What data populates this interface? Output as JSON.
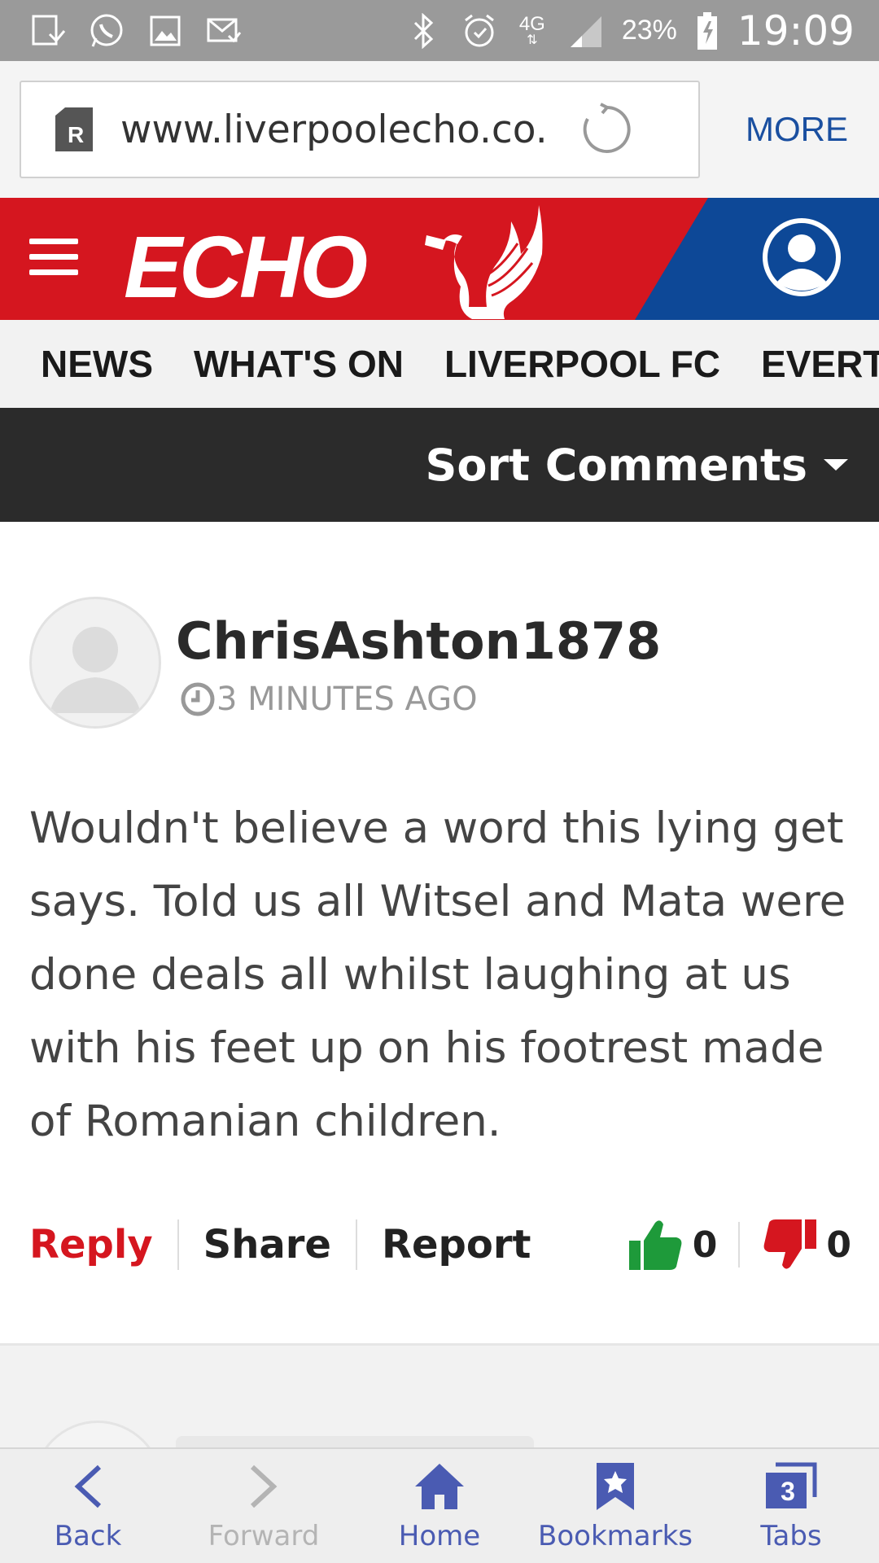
{
  "status_bar": {
    "battery_percent": "23%",
    "network": "4G",
    "time": "19:09"
  },
  "browser": {
    "url": "www.liverpoolecho.co.",
    "more_label": "MORE"
  },
  "header": {
    "logo_text": "ECHO",
    "brand_red": "#d5161f",
    "brand_blue": "#0d4897"
  },
  "nav": {
    "items": [
      "NEWS",
      "WHAT'S ON",
      "LIVERPOOL FC",
      "EVERT"
    ]
  },
  "sort": {
    "label": "Sort Comments"
  },
  "comment": {
    "username": "ChrisAshton1878",
    "time": "3 MINUTES AGO",
    "body": "Wouldn't believe a word this lying get says. Told us all Witsel and Mata were done deals all whilst laughing at us with his feet up on his footrest made of Romanian children.",
    "actions": {
      "reply": "Reply",
      "share": "Share",
      "report": "Report"
    },
    "upvotes": "0",
    "downvotes": "0",
    "up_color": "#1e9a3a",
    "down_color": "#d5161f"
  },
  "toolbar": {
    "back": "Back",
    "forward": "Forward",
    "home": "Home",
    "bookmarks": "Bookmarks",
    "tabs": "Tabs",
    "tab_count": "3",
    "accent": "#4a5bb2"
  }
}
